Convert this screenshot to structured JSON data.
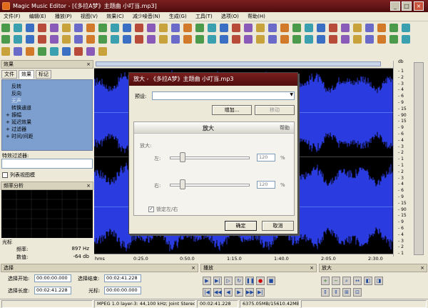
{
  "window": {
    "title": "Magic Music Editor - [《多拉A梦》主题曲 小叮当.mp3]"
  },
  "menu": [
    "文件(F)",
    "编辑(E)",
    "播放(P)",
    "视图(V)",
    "效果(C)",
    "减少噪音(N)",
    "生成(G)",
    "工具(T)",
    "选项(O)",
    "帮助(H)"
  ],
  "left_panel": {
    "title": "效果",
    "tabs": [
      "文件",
      "效果",
      "标记"
    ],
    "tree": [
      "反转",
      "反向",
      "无声",
      "转换通道",
      "振幅",
      "延迟效果",
      "过滤器",
      "时间/间距"
    ],
    "filter_label": "特效过滤器:",
    "list_view_label": "列表视图模",
    "spectrum_title": "频率分析",
    "cursor_title": "光标",
    "freq_label": "频率:",
    "freq_value": "897 Hz",
    "value_label": "数值:",
    "value_value": "-64 db"
  },
  "ruler": {
    "unit": "hms",
    "ticks": [
      "0:25.0",
      "0:50.0",
      "1:15.0",
      "1:40.0",
      "2:05.0",
      "2:30.0"
    ]
  },
  "db_scale": {
    "header": "db",
    "labels": [
      "1",
      "2",
      "3",
      "4",
      "6",
      "9",
      "15",
      "90",
      "15",
      "9",
      "6",
      "4",
      "3",
      "2",
      "1",
      "1",
      "2",
      "3",
      "4",
      "6",
      "9",
      "15",
      "90",
      "15",
      "9",
      "6",
      "4",
      "3",
      "2",
      "1"
    ]
  },
  "dialog": {
    "title": "放大 - 《多拉A梦》主题曲 小叮当.mp3",
    "preset_label": "预设:",
    "add_label": "增加...",
    "remove_label": "移动",
    "section_title": "放大",
    "help_label": "帮助",
    "amplify_label": "放大:",
    "left_label": "左:",
    "left_value": "120",
    "right_label": "右:",
    "right_value": "120",
    "percent": "%",
    "lock_label": "锁定左/右",
    "ok_label": "确定",
    "cancel_label": "取消"
  },
  "selection": {
    "title": "选择",
    "start_label": "选择开始:",
    "start_value": "00:00:00.000",
    "end_label": "选择结束:",
    "end_value": "00:02:41.228",
    "length_label": "选择长度:",
    "length_value": "00:02:41.228",
    "cursor_label": "光标:",
    "cursor_value": "00:00:00.000"
  },
  "playback": {
    "title": "播放"
  },
  "zoom": {
    "title": "放大"
  },
  "status": {
    "format": "MPEG 1.0 layer-3: 44,100 kHz; Joint Stereo",
    "duration": "00:02:41.228",
    "size": "6375.05MB/15610.42MB"
  },
  "colors": {
    "title_bar": "#6a1616",
    "wave": "#2a3be0",
    "panel_tree": "#7c9fcf"
  }
}
